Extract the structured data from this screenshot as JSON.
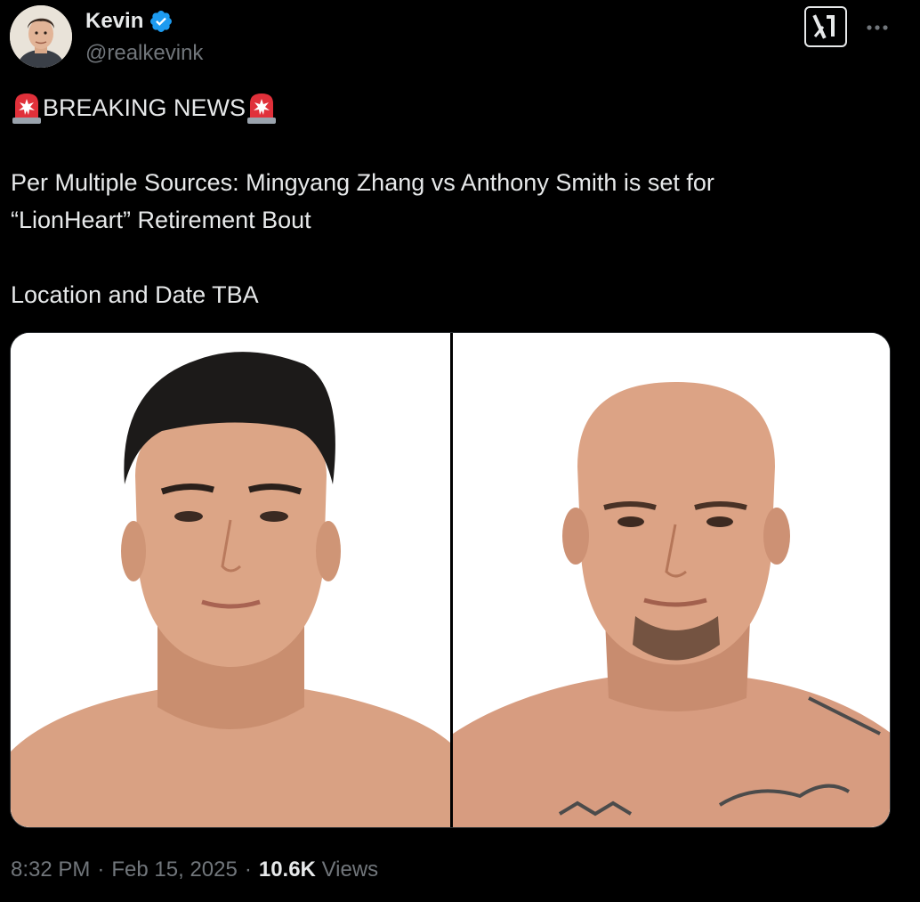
{
  "author": {
    "display_name": "Kevin",
    "handle": "@realkevink",
    "verified": true,
    "avatar_icon": "profile-photo"
  },
  "header_actions": {
    "logo_icon": "x-logo-icon",
    "more_icon": "more-dots-icon"
  },
  "tweet": {
    "siren_icon": "police-siren-emoji",
    "headline": "BREAKING NEWS",
    "body_line_1": "Per Multiple Sources: Mingyang Zhang vs Anthony Smith is set for",
    "body_line_2": "“LionHeart” Retirement Bout",
    "body_line_3": "Location and Date TBA"
  },
  "media": {
    "left_photo": "fighter-portrait-left",
    "right_photo": "fighter-portrait-right"
  },
  "meta": {
    "time": "8:32 PM",
    "sep1": "·",
    "date": "Feb 15, 2025",
    "sep2": "·",
    "views_count": "10.6K",
    "views_label": "Views"
  },
  "colors": {
    "background": "#000000",
    "text_primary": "#e7e9ea",
    "text_secondary": "#71767b",
    "verified_blue": "#1d9bf0",
    "siren_red": "#e0303a"
  }
}
